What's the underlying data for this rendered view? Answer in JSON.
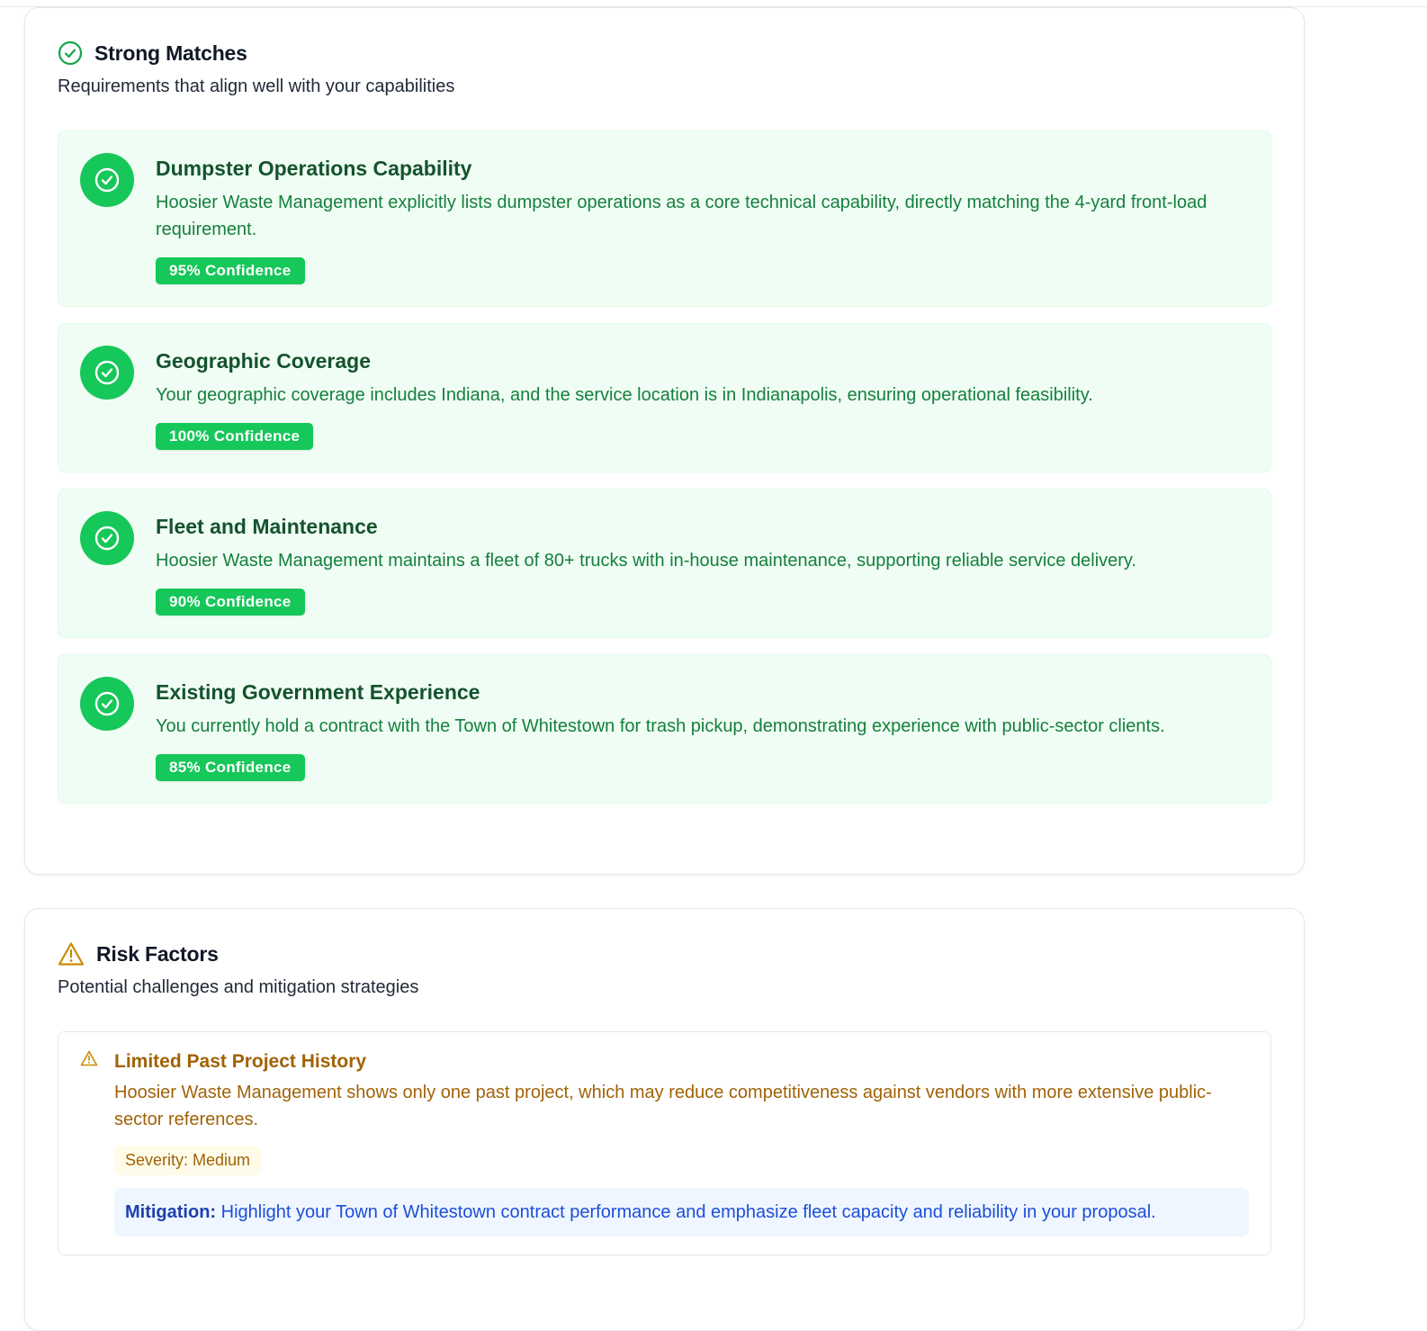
{
  "colors": {
    "success": "#16c75a",
    "success_text": "#15803d",
    "success_title": "#14532d",
    "success_bg": "#f0fdf4",
    "warning_text": "#a16207",
    "warning_icon": "#ca8a04",
    "mitigation_bg": "#eff6ff",
    "mitigation_text": "#1d4ed8"
  },
  "strong_matches": {
    "icon": "check-circle-icon",
    "title": "Strong Matches",
    "description": "Requirements that align well with your capabilities",
    "items": [
      {
        "icon": "check-circle-icon",
        "title": "Dumpster Operations Capability",
        "text": "Hoosier Waste Management explicitly lists dumpster operations as a core technical capability, directly matching the 4-yard front-load requirement.",
        "confidence": "95% Confidence"
      },
      {
        "icon": "check-circle-icon",
        "title": "Geographic Coverage",
        "text": "Your geographic coverage includes Indiana, and the service location is in Indianapolis, ensuring operational feasibility.",
        "confidence": "100% Confidence"
      },
      {
        "icon": "check-circle-icon",
        "title": "Fleet and Maintenance",
        "text": "Hoosier Waste Management maintains a fleet of 80+ trucks with in-house maintenance, supporting reliable service delivery.",
        "confidence": "90% Confidence"
      },
      {
        "icon": "check-circle-icon",
        "title": "Existing Government Experience",
        "text": "You currently hold a contract with the Town of Whitestown for trash pickup, demonstrating experience with public-sector clients.",
        "confidence": "85% Confidence"
      }
    ]
  },
  "risk_factors": {
    "icon": "warning-triangle-icon",
    "title": "Risk Factors",
    "description": "Potential challenges and mitigation strategies",
    "items": [
      {
        "icon": "warning-triangle-icon",
        "title": "Limited Past Project History",
        "text": "Hoosier Waste Management shows only one past project, which may reduce competitiveness against vendors with more extensive public-sector references.",
        "severity": "Severity: Medium",
        "mitigation_label": "Mitigation:",
        "mitigation_text": "Highlight your Town of Whitestown contract performance and emphasize fleet capacity and reliability in your proposal."
      }
    ]
  }
}
